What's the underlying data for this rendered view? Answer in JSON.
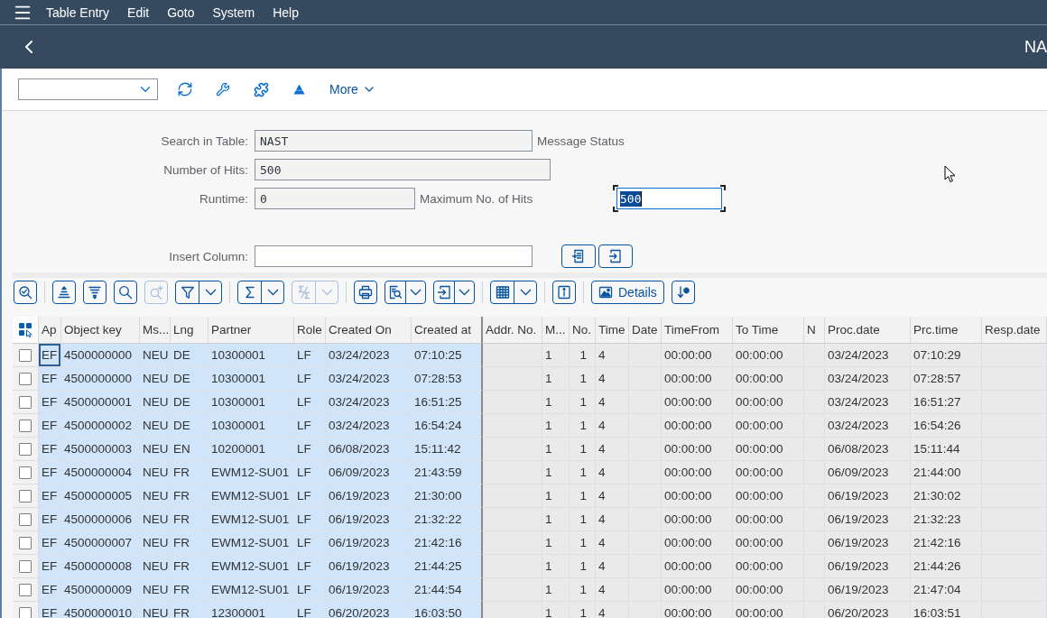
{
  "menu_bar": {
    "items": [
      "Table Entry",
      "Edit",
      "Goto",
      "System",
      "Help"
    ]
  },
  "shell_header": {
    "title": "NA"
  },
  "toolbar": {
    "more_label": "More"
  },
  "selection_screen": {
    "rows": [
      {
        "label": "Search in Table:",
        "field": {
          "value": "NAST",
          "readonly": true
        },
        "description": "Message Status"
      },
      {
        "label": "Number of Hits:",
        "field": {
          "value": "500",
          "readonly": true
        }
      },
      {
        "label": "Runtime:",
        "field": {
          "value": "0",
          "readonly": true
        },
        "description": "Maximum No. of Hits",
        "extra_field": {
          "value": "500",
          "focused": true
        }
      }
    ],
    "insert_column": {
      "label": "Insert Column:",
      "readonly": false
    }
  },
  "alv_toolbar": {
    "groups": [
      {
        "buttons": [
          {
            "kind": "detail",
            "disabled": false,
            "split": false
          }
        ]
      },
      {
        "buttons": [
          {
            "kind": "sort_up",
            "disabled": false,
            "split": false
          },
          {
            "kind": "sort_down",
            "disabled": false,
            "split": false
          },
          {
            "kind": "find",
            "disabled": false,
            "split": false
          },
          {
            "kind": "find_next",
            "disabled": true,
            "split": false
          },
          {
            "kind": "filter",
            "disabled": false,
            "split": true
          }
        ]
      },
      {
        "buttons": [
          {
            "kind": "sum",
            "disabled": false,
            "split": true
          },
          {
            "kind": "subtotal",
            "disabled": true,
            "split": true
          }
        ]
      },
      {
        "buttons": [
          {
            "kind": "print",
            "disabled": false,
            "split": false
          },
          {
            "kind": "view",
            "disabled": false,
            "split": true
          },
          {
            "kind": "export",
            "disabled": false,
            "split": true
          }
        ]
      },
      {
        "buttons": [
          {
            "kind": "layout",
            "disabled": false,
            "split": true
          }
        ]
      },
      {
        "buttons": [
          {
            "kind": "info",
            "disabled": false,
            "split": false
          }
        ]
      },
      {
        "buttons": [
          {
            "kind": "details",
            "label": "Details",
            "disabled": false,
            "split": false
          },
          {
            "kind": "graphic",
            "disabled": false,
            "split": false
          }
        ]
      }
    ]
  },
  "table": {
    "columns": [
      {
        "label": "Ap",
        "key": true
      },
      {
        "label": "Object key",
        "key": true
      },
      {
        "label": "Ms...",
        "key": true
      },
      {
        "label": "Lng",
        "key": true
      },
      {
        "label": "Partner",
        "key": true
      },
      {
        "label": "Role",
        "key": true
      },
      {
        "label": "Created On",
        "key": true
      },
      {
        "label": "Created at",
        "key": true
      },
      {
        "label": "Addr. No.",
        "key": false
      },
      {
        "label": "M...",
        "key": false
      },
      {
        "label": "No.",
        "key": false
      },
      {
        "label": "Time",
        "key": false
      },
      {
        "label": "Date",
        "key": false
      },
      {
        "label": "TimeFrom",
        "key": false
      },
      {
        "label": "To Time",
        "key": false
      },
      {
        "label": "N",
        "key": false
      },
      {
        "label": "Proc.date",
        "key": false
      },
      {
        "label": "Prc.time",
        "key": false
      },
      {
        "label": "Resp.date",
        "key": false
      }
    ],
    "rows": [
      {
        "checked": false,
        "focused": true,
        "cells": [
          "EF",
          "4500000000",
          "NEU",
          "DE",
          "10300001",
          "LF",
          "03/24/2023",
          "07:10:25",
          null,
          "1",
          "1",
          "4",
          null,
          "00:00:00",
          "00:00:00",
          null,
          "03/24/2023",
          "07:10:29",
          null
        ]
      },
      {
        "checked": false,
        "focused": false,
        "cells": [
          "EF",
          "4500000000",
          "NEU",
          "DE",
          "10300001",
          "LF",
          "03/24/2023",
          "07:28:53",
          null,
          "1",
          "1",
          "4",
          null,
          "00:00:00",
          "00:00:00",
          null,
          "03/24/2023",
          "07:28:57",
          null
        ]
      },
      {
        "checked": false,
        "focused": false,
        "cells": [
          "EF",
          "4500000001",
          "NEU",
          "DE",
          "10300001",
          "LF",
          "03/24/2023",
          "16:51:25",
          null,
          "1",
          "1",
          "4",
          null,
          "00:00:00",
          "00:00:00",
          null,
          "03/24/2023",
          "16:51:27",
          null
        ]
      },
      {
        "checked": false,
        "focused": false,
        "cells": [
          "EF",
          "4500000002",
          "NEU",
          "DE",
          "10300001",
          "LF",
          "03/24/2023",
          "16:54:24",
          null,
          "1",
          "1",
          "4",
          null,
          "00:00:00",
          "00:00:00",
          null,
          "03/24/2023",
          "16:54:26",
          null
        ]
      },
      {
        "checked": false,
        "focused": false,
        "cells": [
          "EF",
          "4500000003",
          "NEU",
          "EN",
          "10200001",
          "LF",
          "06/08/2023",
          "15:11:42",
          null,
          "1",
          "1",
          "4",
          null,
          "00:00:00",
          "00:00:00",
          null,
          "06/08/2023",
          "15:11:44",
          null
        ]
      },
      {
        "checked": false,
        "focused": false,
        "cells": [
          "EF",
          "4500000004",
          "NEU",
          "FR",
          "EWM12-SU01",
          "LF",
          "06/09/2023",
          "21:43:59",
          null,
          "1",
          "1",
          "4",
          null,
          "00:00:00",
          "00:00:00",
          null,
          "06/09/2023",
          "21:44:00",
          null
        ]
      },
      {
        "checked": false,
        "focused": false,
        "cells": [
          "EF",
          "4500000005",
          "NEU",
          "FR",
          "EWM12-SU01",
          "LF",
          "06/19/2023",
          "21:30:00",
          null,
          "1",
          "1",
          "4",
          null,
          "00:00:00",
          "00:00:00",
          null,
          "06/19/2023",
          "21:30:02",
          null
        ]
      },
      {
        "checked": false,
        "focused": false,
        "cells": [
          "EF",
          "4500000006",
          "NEU",
          "FR",
          "EWM12-SU01",
          "LF",
          "06/19/2023",
          "21:32:22",
          null,
          "1",
          "1",
          "4",
          null,
          "00:00:00",
          "00:00:00",
          null,
          "06/19/2023",
          "21:32:23",
          null
        ]
      },
      {
        "checked": false,
        "focused": false,
        "cells": [
          "EF",
          "4500000007",
          "NEU",
          "FR",
          "EWM12-SU01",
          "LF",
          "06/19/2023",
          "21:42:16",
          null,
          "1",
          "1",
          "4",
          null,
          "00:00:00",
          "00:00:00",
          null,
          "06/19/2023",
          "21:42:16",
          null
        ]
      },
      {
        "checked": false,
        "focused": false,
        "cells": [
          "EF",
          "4500000008",
          "NEU",
          "FR",
          "EWM12-SU01",
          "LF",
          "06/19/2023",
          "21:44:25",
          null,
          "1",
          "1",
          "4",
          null,
          "00:00:00",
          "00:00:00",
          null,
          "06/19/2023",
          "21:44:26",
          null
        ]
      },
      {
        "checked": false,
        "focused": false,
        "cells": [
          "EF",
          "4500000009",
          "NEU",
          "FR",
          "EWM12-SU01",
          "LF",
          "06/19/2023",
          "21:44:54",
          null,
          "1",
          "1",
          "4",
          null,
          "00:00:00",
          "00:00:00",
          null,
          "06/19/2023",
          "21:47:04",
          null
        ]
      },
      {
        "checked": false,
        "focused": false,
        "cells": [
          "EF",
          "4500000010",
          "NEU",
          "FR",
          "12300001",
          "LF",
          "06/20/2023",
          "16:03:50",
          null,
          "1",
          "1",
          "4",
          null,
          "00:00:00",
          "00:00:00",
          null,
          "06/20/2023",
          "16:03:51",
          null
        ]
      }
    ]
  }
}
